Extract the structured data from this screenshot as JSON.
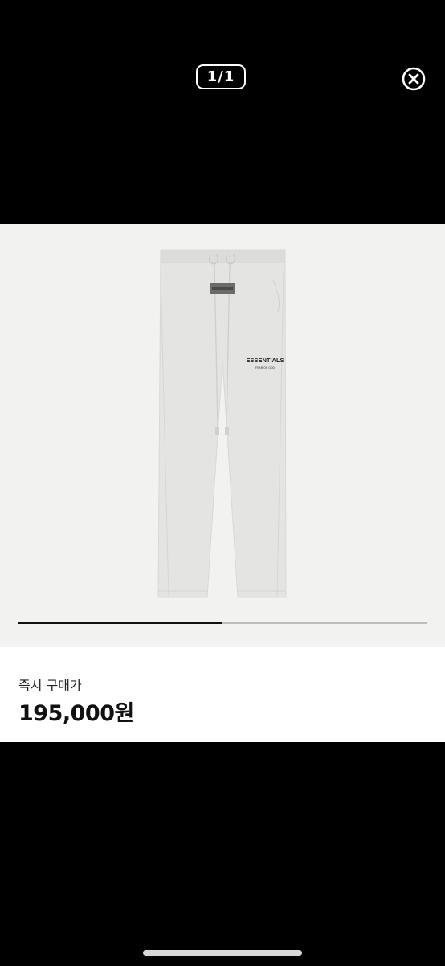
{
  "viewer": {
    "counter_text": "1/1",
    "close_icon": "close-circle-icon",
    "image_progress_fraction": 0.5
  },
  "product": {
    "brand_print": "ESSENTIALS",
    "brand_subprint": "FEAR OF GOD"
  },
  "price": {
    "label": "즉시 구매가",
    "value": "195,000원"
  },
  "colors": {
    "background": "#000000",
    "image_bg": "#f2f2f1",
    "pants": "#e3e3e1"
  }
}
